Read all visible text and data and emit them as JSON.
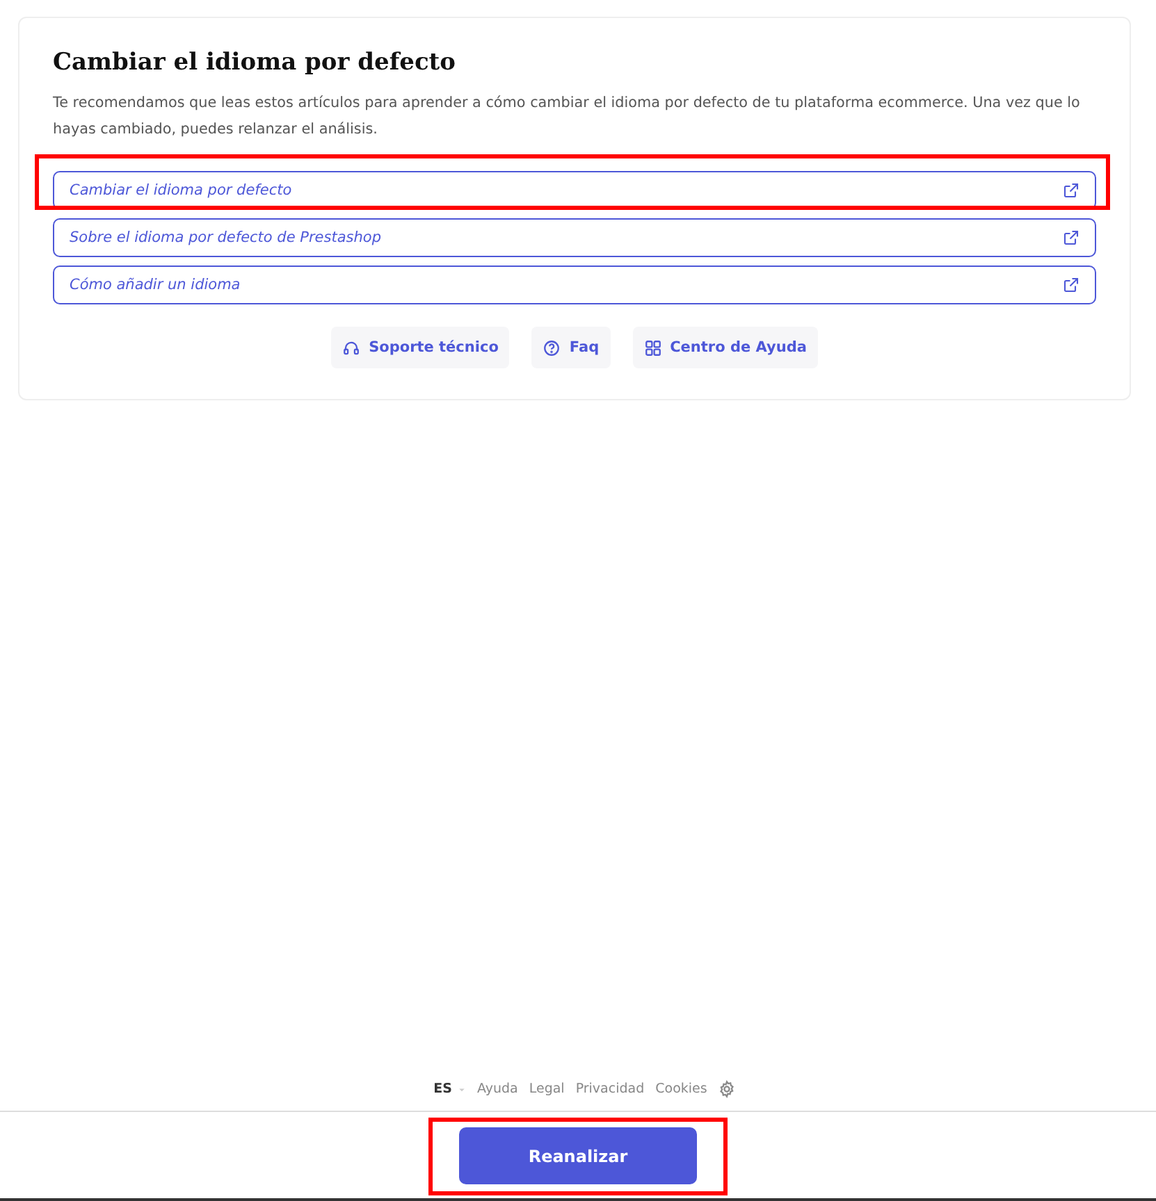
{
  "card": {
    "title": "Cambiar el idioma por defecto",
    "description": "Te recomendamos que leas estos artículos para aprender a cómo cambiar el idioma por defecto de tu plataforma ecommerce. Una vez que lo hayas cambiado, puedes relanzar el análisis.",
    "links": [
      {
        "label": "Cambiar el idioma por defecto",
        "highlighted": true
      },
      {
        "label": "Sobre el idioma por defecto de Prestashop",
        "highlighted": false
      },
      {
        "label": "Cómo añadir un idioma",
        "highlighted": false
      }
    ],
    "help_buttons": [
      {
        "kind": "support",
        "label": "Soporte técnico"
      },
      {
        "kind": "faq",
        "label": "Faq"
      },
      {
        "kind": "center",
        "label": "Centro de Ayuda"
      }
    ]
  },
  "footer": {
    "language": "ES",
    "links": [
      "Ayuda",
      "Legal",
      "Privacidad",
      "Cookies"
    ]
  },
  "action_button": {
    "label": "Reanalizar",
    "highlighted": true
  }
}
